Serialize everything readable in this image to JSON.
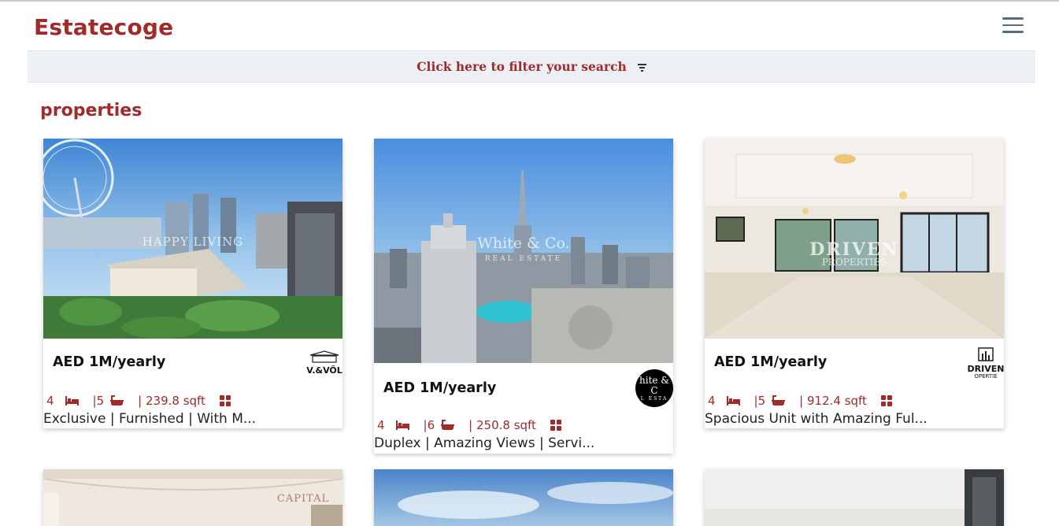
{
  "header": {
    "brand": "Estatecoge"
  },
  "filter": {
    "label": "Click here to filter your search"
  },
  "section": {
    "title": "properties"
  },
  "listings": [
    {
      "price": "AED 1M/yearly",
      "beds": "4",
      "baths": "|5",
      "area": "| 239.8 sqft",
      "description": "Exclusive | Furnished | With M...",
      "watermark": "HAPPY LIVING",
      "agent_logo_text": "V.&VÖL"
    },
    {
      "price": "AED 1M/yearly",
      "beds": "4",
      "baths": "|6",
      "area": "| 250.8 sqft",
      "description": "Duplex | Amazing Views | Servi...",
      "watermark": "White & Co.",
      "watermark_sub": "REAL ESTATE",
      "agent_logo_text": "hite & C",
      "agent_logo_sub": "L ESTA"
    },
    {
      "price": "AED 1M/yearly",
      "beds": "4",
      "baths": "|5",
      "area": "| 912.4 sqft",
      "description": "Spacious Unit with Amazing Ful...",
      "watermark": "DRIVEN",
      "watermark_sub": "PROPERTIES",
      "agent_logo_text": "DRIVEN",
      "agent_logo_sub": "OPERTIE"
    },
    {
      "watermark": "CAPITAL"
    },
    {},
    {}
  ],
  "colors": {
    "brand": "#a22a2a",
    "filter_bg": "#edf1f5",
    "menu": "#556b84"
  }
}
